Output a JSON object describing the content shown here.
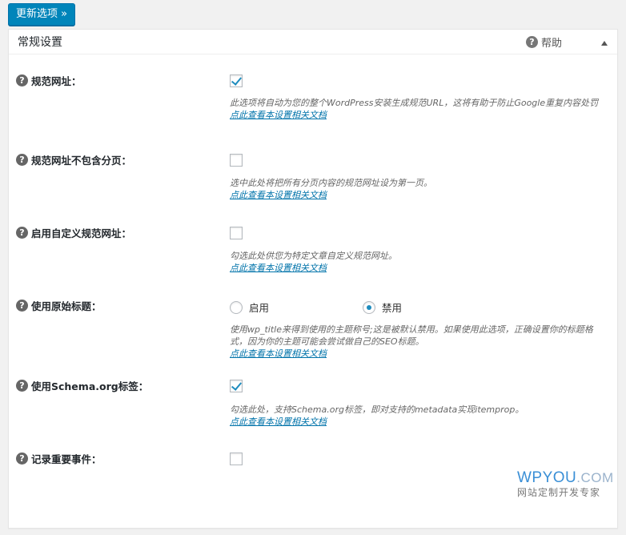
{
  "toolbar": {
    "update_label": "更新选项 »"
  },
  "panel": {
    "title": "常规设置",
    "help_label": "帮助"
  },
  "doc_link_label": "点此查看本设置相关文档",
  "settings": [
    {
      "label": "规范网址：",
      "type": "checkbox",
      "checked": true,
      "description": "此选项将自动为您的整个WordPress安装生成规范URL，这将有助于防止Google重复内容处罚"
    },
    {
      "label": "规范网址不包含分页：",
      "type": "checkbox",
      "checked": false,
      "description": "选中此处将把所有分页内容的规范网址设为第一页。"
    },
    {
      "label": "启用自定义规范网址：",
      "type": "checkbox",
      "checked": false,
      "description": "勾选此处供您为特定文章自定义规范网址。"
    },
    {
      "label": "使用原始标题：",
      "type": "radio",
      "options": [
        "启用",
        "禁用"
      ],
      "selected": "禁用",
      "description": "使用wp_title来得到使用的主题称号;这是被默认禁用。如果使用此选项，正确设置你的标题格式，因为你的主题可能会尝试做自己的SEO标题。"
    },
    {
      "label": "使用Schema.org标签：",
      "type": "checkbox",
      "checked": true,
      "description": "勾选此处，支持Schema.org标签，即对支持的metadata实现itemprop。"
    },
    {
      "label": "记录重要事件：",
      "type": "checkbox",
      "checked": false,
      "description": ""
    }
  ],
  "watermark": {
    "brand": "WPYOU",
    "suffix": ".COM",
    "tagline": "网站定制开发专家"
  }
}
